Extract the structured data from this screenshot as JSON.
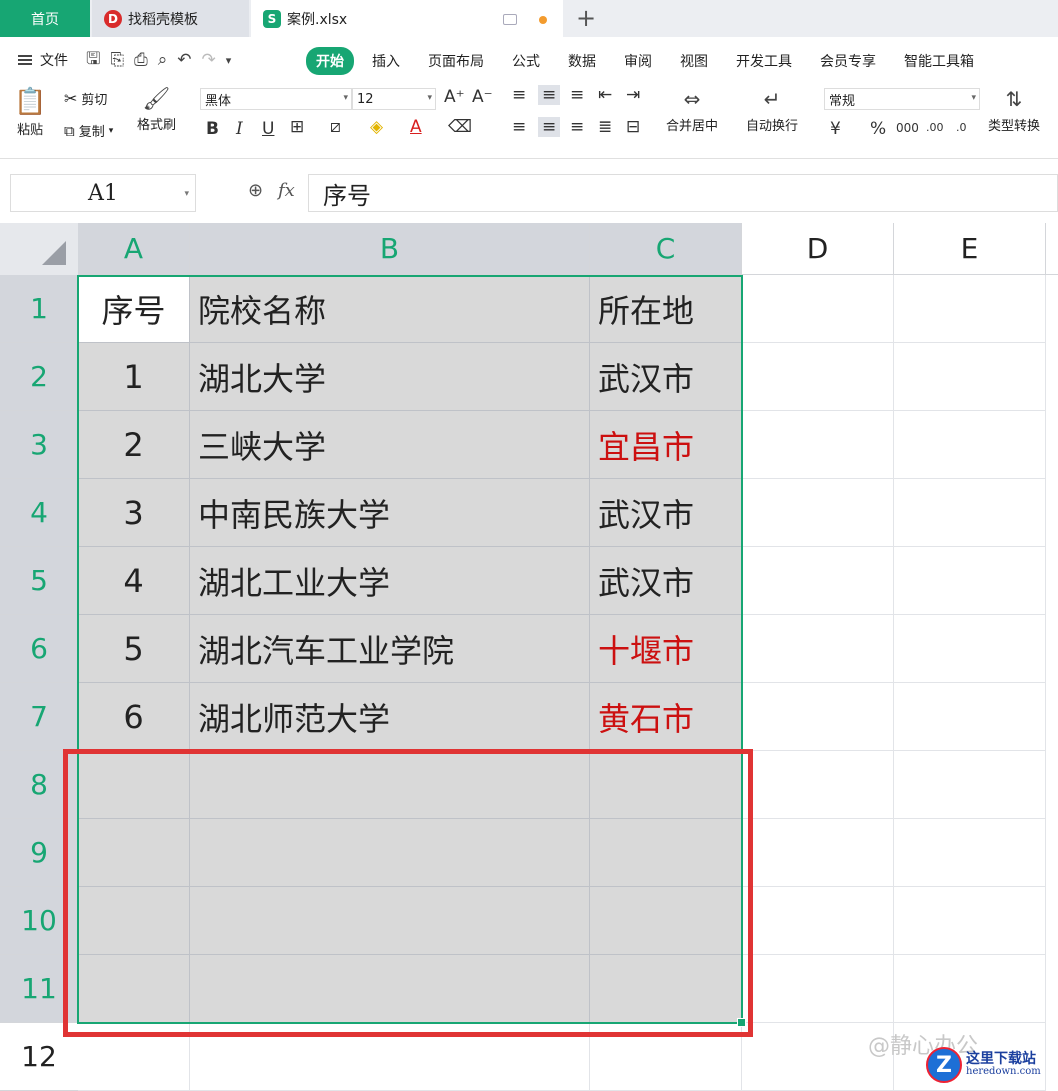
{
  "tabs": {
    "home": "首页",
    "template": "找稻壳模板",
    "file": "案例.xlsx",
    "new_tab": "+"
  },
  "menu": {
    "file": "文件",
    "items": [
      "开始",
      "插入",
      "页面布局",
      "公式",
      "数据",
      "审阅",
      "视图",
      "开发工具",
      "会员专享",
      "智能工具箱"
    ],
    "active": "开始"
  },
  "ribbon": {
    "paste": "粘贴",
    "cut": "剪切",
    "copy": "复制",
    "format_painter": "格式刷",
    "font": "黑体",
    "font_size": "12",
    "merge_center": "合并居中",
    "wrap_text": "自动换行",
    "number_format": "常规",
    "type_convert": "类型转换",
    "bold": "B",
    "italic": "I",
    "underline": "U",
    "percent": "%"
  },
  "formula_bar": {
    "name_box": "A1",
    "fx": "fx",
    "value": "序号"
  },
  "sheet": {
    "columns": [
      "A",
      "B",
      "C",
      "D",
      "E"
    ],
    "rows": [
      "1",
      "2",
      "3",
      "4",
      "5",
      "6",
      "7",
      "8",
      "9",
      "10",
      "11",
      "12"
    ],
    "cells": [
      [
        "序号",
        "院校名称",
        "所在地"
      ],
      [
        "1",
        "湖北大学",
        "武汉市"
      ],
      [
        "2",
        "三峡大学",
        "宜昌市"
      ],
      [
        "3",
        "中南民族大学",
        "武汉市"
      ],
      [
        "4",
        "湖北工业大学",
        "武汉市"
      ],
      [
        "5",
        "湖北汽车工业学院",
        "十堰市"
      ],
      [
        "6",
        "湖北师范大学",
        "黄石市"
      ]
    ],
    "red_text_color": "#cc1010",
    "accent_color": "#17a673"
  },
  "watermark": "@静心办公",
  "site_logo": {
    "letter": "Z",
    "zh": "这里下载站",
    "en": "heredown.com"
  }
}
